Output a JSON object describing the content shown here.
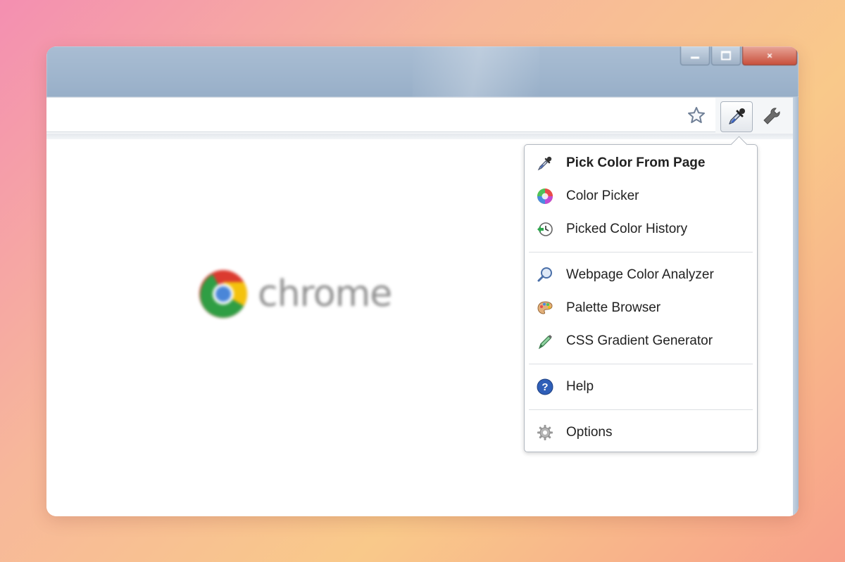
{
  "window": {
    "minimize_icon": "minimize-icon",
    "maximize_icon": "maximize-icon",
    "close_glyph": "×"
  },
  "toolbar": {
    "star_icon": "star-icon",
    "picker_icon": "eyedropper-icon",
    "wrench_icon": "wrench-icon"
  },
  "content": {
    "logo_text": "chrome"
  },
  "menu": {
    "items": [
      {
        "label": "Pick Color From Page",
        "icon": "eyedropper-icon",
        "bold": true
      },
      {
        "label": "Color Picker",
        "icon": "color-wheel-icon"
      },
      {
        "label": "Picked Color History",
        "icon": "history-icon"
      },
      {
        "label": "Webpage Color Analyzer",
        "icon": "magnifier-icon"
      },
      {
        "label": "Palette Browser",
        "icon": "palette-icon"
      },
      {
        "label": "CSS Gradient Generator",
        "icon": "pen-icon"
      },
      {
        "label": "Help",
        "icon": "help-icon"
      },
      {
        "label": "Options",
        "icon": "gear-icon"
      }
    ]
  },
  "colors": {
    "title_bar": "#a9bdd3",
    "close_button": "#c8503c",
    "menu_border": "#b3b9c1",
    "chrome_text": "#8f8f8f"
  }
}
